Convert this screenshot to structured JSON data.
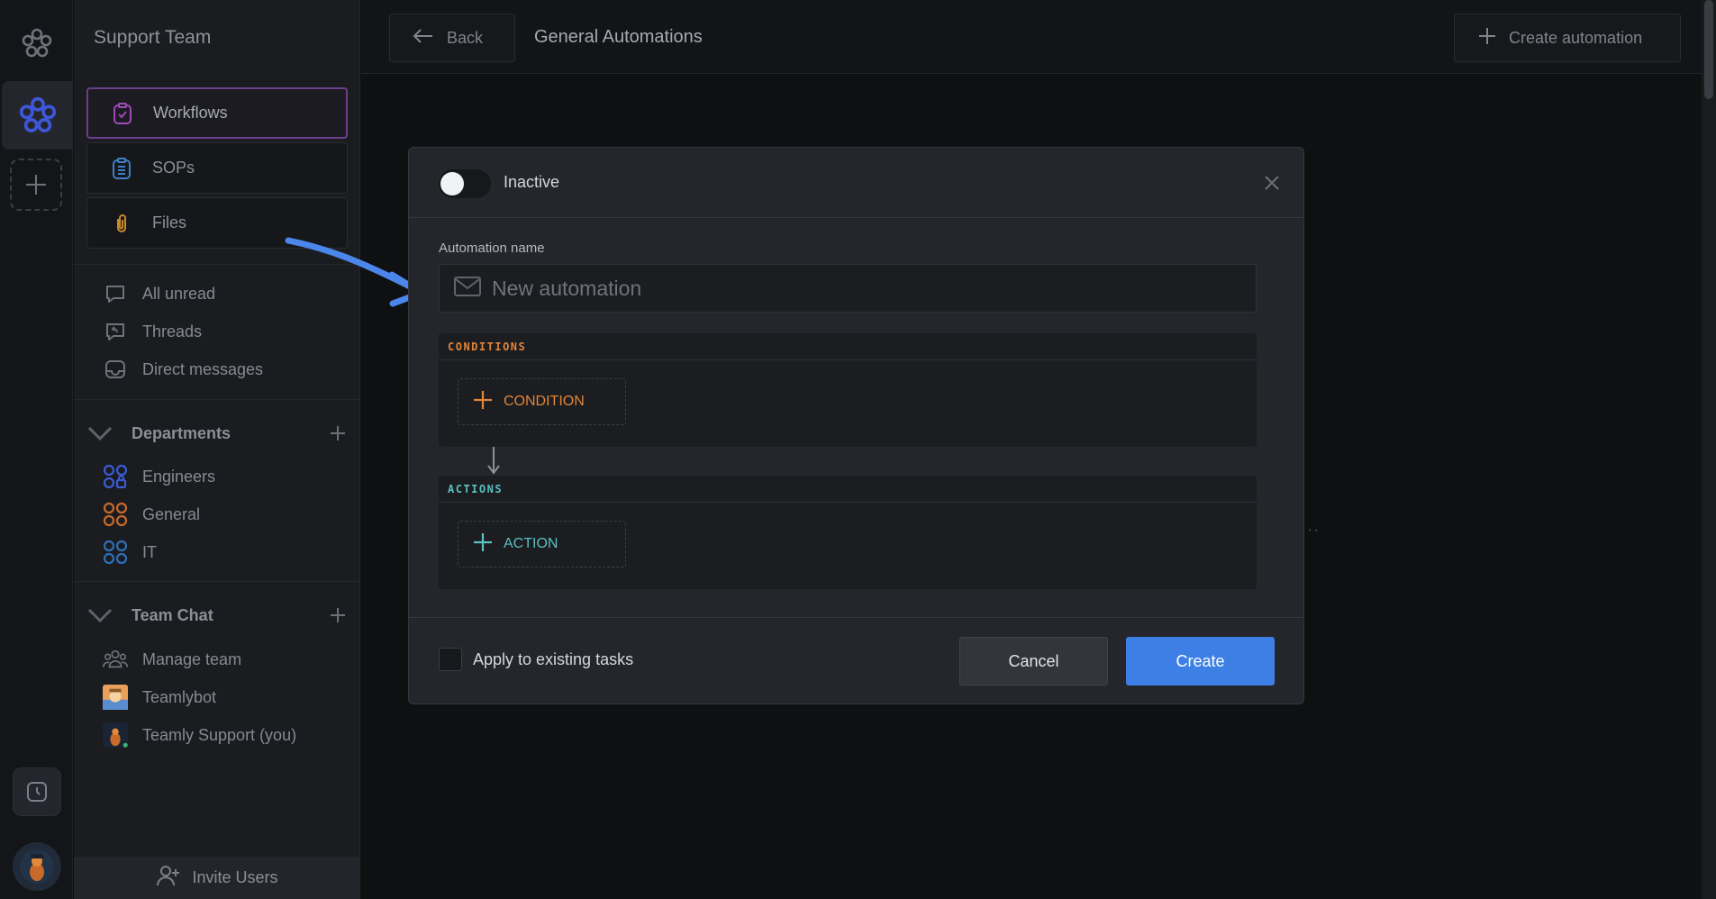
{
  "sidebar": {
    "team_name": "Support Team",
    "nav_cards": [
      {
        "label": "Workflows",
        "icon": "clipboard-check-icon",
        "active": true
      },
      {
        "label": "SOPs",
        "icon": "clipboard-list-icon",
        "active": false
      },
      {
        "label": "Files",
        "icon": "paperclip-icon",
        "active": false
      }
    ],
    "inbox_items": [
      {
        "label": "All unread",
        "icon": "chat-bubble-icon"
      },
      {
        "label": "Threads",
        "icon": "thread-reply-icon"
      },
      {
        "label": "Direct messages",
        "icon": "inbox-icon"
      }
    ],
    "departments": {
      "title": "Departments",
      "items": [
        {
          "label": "Engineers",
          "color": "#3b5bd6"
        },
        {
          "label": "General",
          "color": "#c86a2c"
        },
        {
          "label": "IT",
          "color": "#2f6fb8"
        }
      ]
    },
    "team_chat": {
      "title": "Team Chat",
      "items": [
        {
          "label": "Manage team",
          "icon": "team-icon"
        },
        {
          "label": "Teamlybot",
          "icon": "bot-avatar"
        },
        {
          "label": "Teamly Support (you)",
          "icon": "user-avatar"
        }
      ]
    },
    "invite_label": "Invite Users"
  },
  "topbar": {
    "back_label": "Back",
    "title": "General Automations",
    "create_label": "Create automation"
  },
  "modal": {
    "status_label": "Inactive",
    "toggle_on": false,
    "name_label": "Automation name",
    "name_placeholder": "New automation",
    "conditions_title": "CONDITIONS",
    "condition_button": "CONDITION",
    "actions_title": "ACTIONS",
    "action_button": "ACTION",
    "apply_label": "Apply to existing tasks",
    "cancel_label": "Cancel",
    "create_label": "Create"
  },
  "colors": {
    "accent_blue": "#3d7fe4",
    "conditions_orange": "#e0853a",
    "actions_teal": "#5bc0c0",
    "workflow_purple": "#6a3f8e"
  }
}
